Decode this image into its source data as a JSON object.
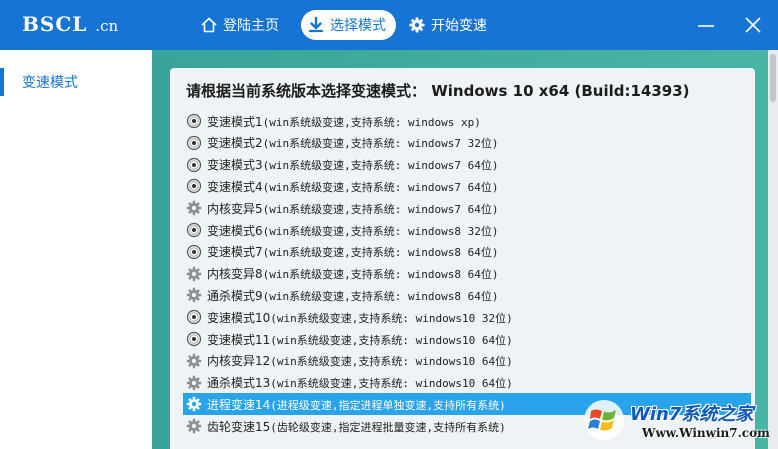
{
  "titlebar": {
    "logo_main": "BSCL",
    "logo_suffix": ".cn",
    "nav": [
      {
        "label": "登陆主页",
        "icon": "home-icon"
      },
      {
        "label": "选择模式",
        "icon": "download-icon"
      },
      {
        "label": "开始变速",
        "icon": "gear-icon"
      }
    ],
    "window_controls": [
      "minimize-icon",
      "close-icon"
    ]
  },
  "sidebar": {
    "items": [
      {
        "label": "变速模式",
        "active": true
      }
    ]
  },
  "main": {
    "heading": "请根据当前系统版本选择变速模式：  Windows 10  x64 (Build:14393)",
    "options": [
      {
        "icon": "radio-icon",
        "name": "变速模式1",
        "desc": "(win系统级变速,支持系统: windows xp)"
      },
      {
        "icon": "radio-icon",
        "name": "变速模式2",
        "desc": "(win系统级变速,支持系统: windows7 32位)"
      },
      {
        "icon": "radio-icon",
        "name": "变速模式3",
        "desc": "(win系统级变速,支持系统: windows7 64位)"
      },
      {
        "icon": "radio-icon",
        "name": "变速模式4",
        "desc": "(win系统级变速,支持系统: windows7 64位)"
      },
      {
        "icon": "gear-icon",
        "name": "内核变异5",
        "desc": "(win系统级变速,支持系统: windows7 64位)"
      },
      {
        "icon": "radio-icon",
        "name": "变速模式6",
        "desc": "(win系统级变速,支持系统: windows8 32位)"
      },
      {
        "icon": "radio-icon",
        "name": "变速模式7",
        "desc": "(win系统级变速,支持系统: windows8 64位)"
      },
      {
        "icon": "gear-icon",
        "name": "内核变异8",
        "desc": "(win系统级变速,支持系统: windows8 64位)"
      },
      {
        "icon": "gear-icon",
        "name": "通杀模式9",
        "desc": "(win系统级变速,支持系统: windows8 64位)"
      },
      {
        "icon": "radio-icon",
        "name": "变速模式10",
        "desc": "(win系统级变速,支持系统: windows10 32位)"
      },
      {
        "icon": "radio-icon",
        "name": "变速模式11",
        "desc": "(win系统级变速,支持系统: windows10 64位)"
      },
      {
        "icon": "gear-icon",
        "name": "内核变异12",
        "desc": "(win系统级变速,支持系统: windows10 64位)"
      },
      {
        "icon": "gear-icon",
        "name": "通杀模式13",
        "desc": "(win系统级变速,支持系统: windows10 64位)"
      },
      {
        "icon": "gear-icon",
        "name": "进程变速14",
        "desc": "(进程级变速,指定进程单独变速,支持所有系统)",
        "selected": true
      },
      {
        "icon": "gear-icon",
        "name": "齿轮变速15",
        "desc": "(齿轮级变速,指定进程批量变速,支持所有系统)"
      }
    ]
  },
  "watermark": {
    "title": "Win7系统之家",
    "url": "Www.Winwin7.com"
  },
  "colors": {
    "accent": "#1773d4",
    "selected_row": "#29a3ea",
    "panel_bg": "#eef3f6",
    "content_bg": "#3aa39a"
  }
}
